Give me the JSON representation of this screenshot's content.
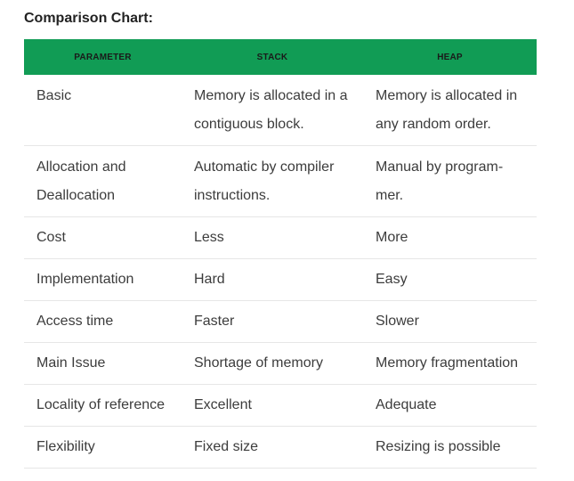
{
  "title": "Comparison Chart:",
  "table": {
    "headers": [
      "PARAMETER",
      "STACK",
      "HEAP"
    ],
    "rows": [
      [
        "Basic",
        "Memory is allocated in a contiguous block.",
        "Memory is allocated in any random order."
      ],
      [
        "Allocation and Deallocation",
        "Automatic by compiler instructions.",
        "Manual by program-mer."
      ],
      [
        "Cost",
        "Less",
        "More"
      ],
      [
        "Implementation",
        "Hard",
        "Easy"
      ],
      [
        "Access time",
        "Faster",
        "Slower"
      ],
      [
        "Main Issue",
        "Shortage of memory",
        "Memory fragmentation"
      ],
      [
        "Locality of reference",
        "Excellent",
        "Adequate"
      ],
      [
        "Flexibility",
        "Fixed size",
        "Resizing is possible"
      ]
    ]
  }
}
